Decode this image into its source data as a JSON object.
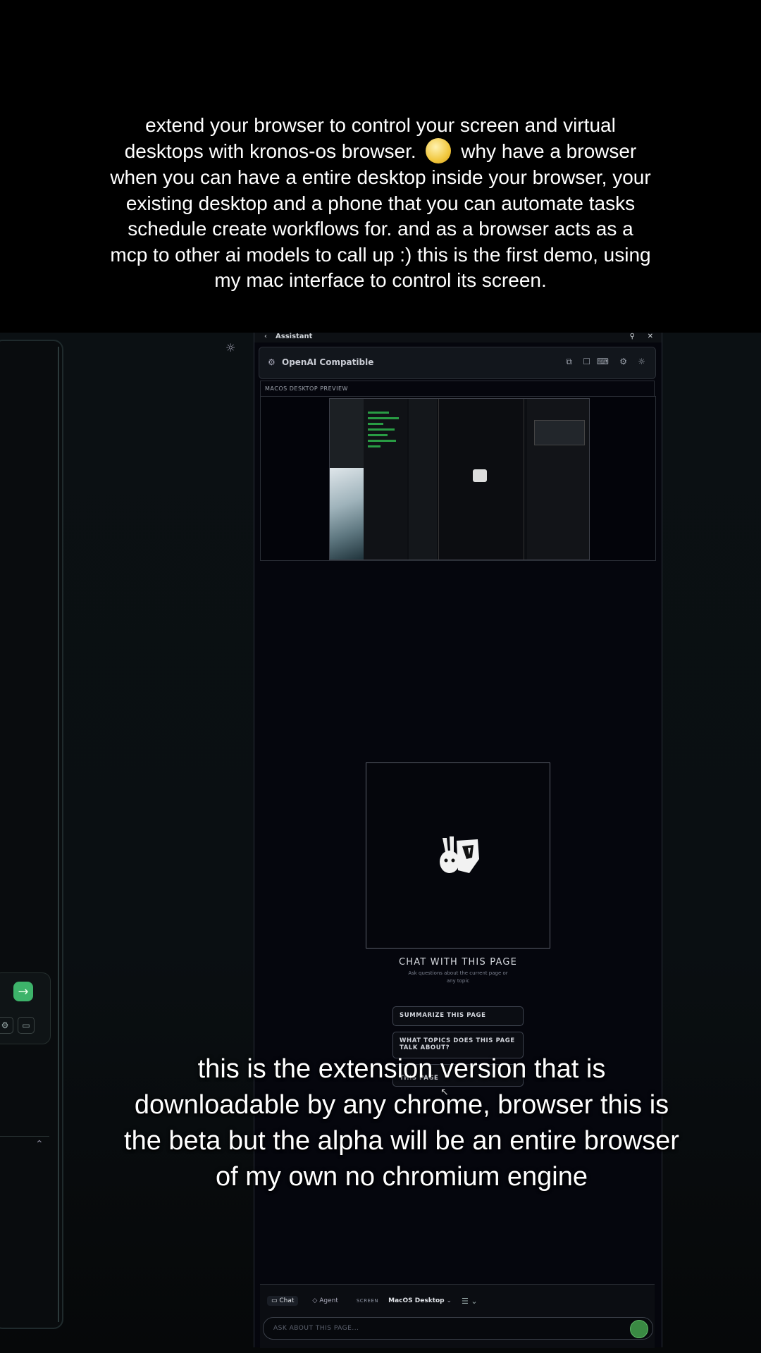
{
  "caption_top": {
    "lines": [
      "extend your browser to control your screen and virtual",
      "desktops with kronos-os browser.",
      "why have a browser",
      "when you can have a entire desktop inside your browser, your",
      "existing desktop and a phone that you can automate tasks",
      "schedule create workflows for. and as a browser acts as a",
      "mcp to other ai models to call up :) this is the first demo, using",
      "my mac interface to control its screen."
    ],
    "emoji": "grinning-face-emoji"
  },
  "assistant": {
    "title": "Assistant",
    "model_name": "OpenAI Compatible",
    "preview_label": "MACOS DESKTOP PREVIEW",
    "chat_title": "CHAT WITH THIS PAGE",
    "chat_subtitle": "Ask questions about the current page or any topic",
    "suggestions": [
      "SUMMARIZE THIS PAGE",
      "WHAT TOPICS DOES THIS PAGE TALK ABOUT?",
      "THIS PAGE"
    ],
    "modes": [
      "Chat",
      "Agent"
    ],
    "screen_label": "SCREEN",
    "screen_value": "MacOS Desktop",
    "input_placeholder": "ASK ABOUT THIS PAGE..."
  },
  "icons": {
    "back": "chevron-left-icon",
    "pin": "pin-icon",
    "close": "close-icon",
    "model": "gear-chip-icon",
    "header_actions": [
      "external-link-icon",
      "square-icon",
      "message-icon",
      "settings-icon",
      "sun-icon"
    ],
    "send": "arrow-right-icon"
  },
  "colors": {
    "accent_green": "#3db36a",
    "panel_bg": "#05060d"
  },
  "caption_bottom": {
    "lines": [
      "this is the extension version that is",
      "downloadable by any chrome, browser this is",
      "the beta but the alpha will be an entire browser",
      "of my own no chromium  engine"
    ]
  }
}
